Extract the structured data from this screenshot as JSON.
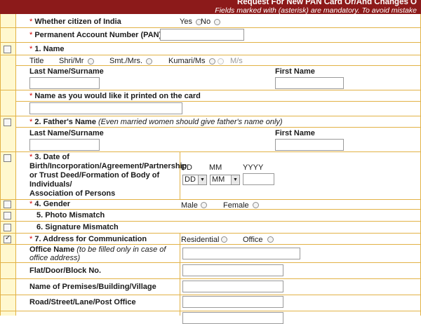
{
  "header": {
    "title": "Request For New PAN Card Or/And Changes O",
    "subtitle": "Fields marked with   (asterisk) are mandatory.  To avoid mistake"
  },
  "citizen": {
    "label": "Whether citizen of India",
    "yes": "Yes",
    "no": "No"
  },
  "pan": {
    "label": "Permanent Account Number (PAN)",
    "value": ""
  },
  "name": {
    "section": "1. Name",
    "title_label": "Title",
    "titles": [
      "Shri/Mr",
      "Smt./Mrs.",
      "Kumari/Ms",
      "M/s"
    ],
    "last_label": "Last Name/Surname",
    "first_label": "First Name"
  },
  "printed": {
    "label": "Name as you would like it printed on the card"
  },
  "father": {
    "section": "2. Father's Name",
    "note": "(Even married women should give father's name only)",
    "last_label": "Last Name/Surname",
    "first_label": "First Name"
  },
  "dob": {
    "lines": [
      "3. Date of",
      "Birth/Incorporation/Agreement/Partnership",
      "or Trust Deed/Formation of Body of",
      "Individuals/",
      "Association of Persons"
    ],
    "dd": "DD",
    "mm": "MM",
    "yyyy": "YYYY",
    "dd_value": "DD",
    "mm_value": "MM"
  },
  "gender": {
    "section": "4. Gender",
    "male": "Male",
    "female": "Female"
  },
  "photo": {
    "label": "5. Photo Mismatch"
  },
  "signature": {
    "label": "6. Signature Mismatch"
  },
  "address": {
    "section": "7. Address for Communication",
    "residential": "Residential",
    "office": "Office"
  },
  "office_name": {
    "label": "Office Name",
    "note": "(to be filled only in case of",
    "note2": "office address)"
  },
  "flat": {
    "label": "Flat/Door/Block No."
  },
  "premises": {
    "label": "Name of Premises/Building/Village"
  },
  "road": {
    "label": "Road/Street/Lane/Post Office"
  },
  "asterisk": "*"
}
